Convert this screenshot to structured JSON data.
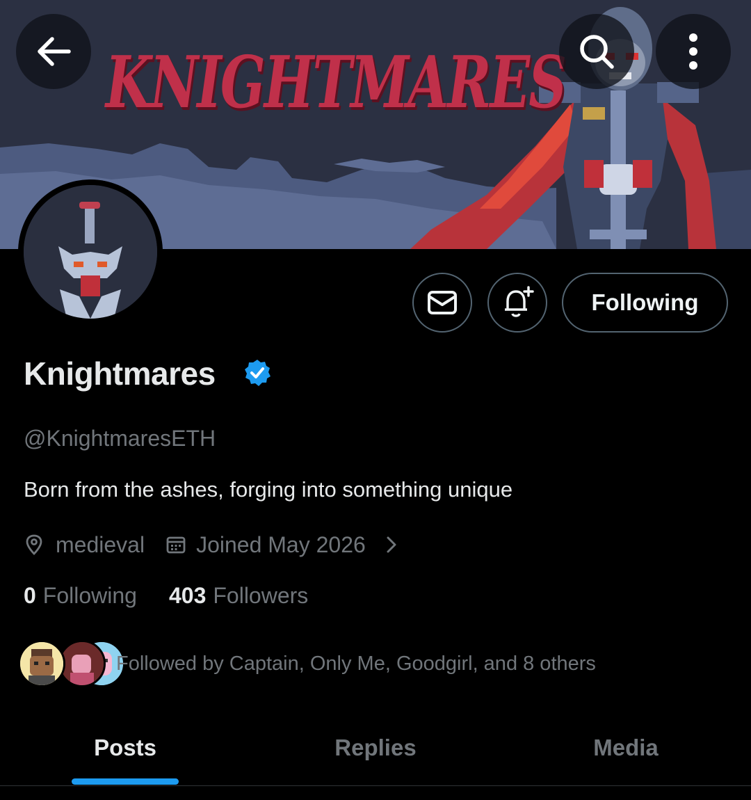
{
  "banner": {
    "logo_text": "KNIGHTMARES"
  },
  "nav": {
    "back_icon": "arrow-left-icon",
    "search_icon": "search-icon",
    "more_icon": "more-vertical-icon"
  },
  "actions": {
    "message_icon": "envelope-icon",
    "notify_icon": "bell-plus-icon",
    "following_label": "Following"
  },
  "profile": {
    "display_name": "Knightmares",
    "verified": true,
    "handle": "@KnightmaresETH",
    "bio": "Born from the ashes, forging into something unique",
    "location": "medieval",
    "joined": "Joined May 2026",
    "following_count": "0",
    "following_label": "Following",
    "followers_count": "403",
    "followers_label": "Followers",
    "followed_by": "Followed by Captain, Only Me, Goodgirl, and 8 others"
  },
  "tabs": [
    {
      "label": "Posts",
      "active": true
    },
    {
      "label": "Replies",
      "active": false
    },
    {
      "label": "Media",
      "active": false
    }
  ],
  "colors": {
    "accent": "#1d9bf0",
    "background": "#000000",
    "banner_bg": "#2b3042",
    "logo_red": "#c0304a",
    "muted_text": "#71767b",
    "primary_text": "#e7e9ea",
    "border": "#536471"
  }
}
